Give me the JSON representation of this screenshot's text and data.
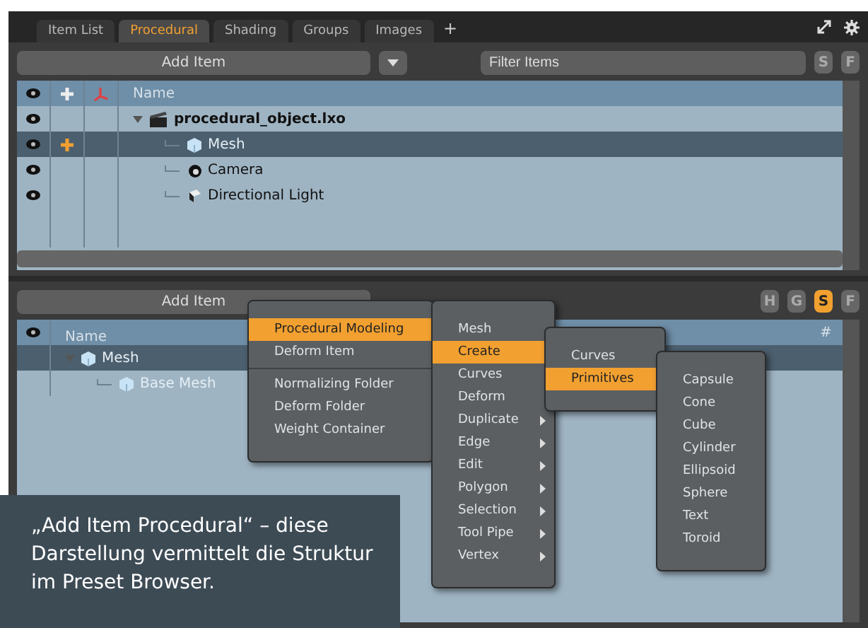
{
  "tabs": [
    {
      "label": "Item List",
      "selected": false
    },
    {
      "label": "Procedural",
      "selected": true
    },
    {
      "label": "Shading",
      "selected": false
    },
    {
      "label": "Groups",
      "selected": false
    },
    {
      "label": "Images",
      "selected": false
    }
  ],
  "add_tab": "+",
  "top_panel": {
    "add_button": "Add Item",
    "filter": {
      "placeholder": "Filter Items"
    },
    "toggles": [
      {
        "label": "S",
        "selected": false
      },
      {
        "label": "F",
        "selected": false
      }
    ],
    "header": "Name",
    "rows": [
      {
        "label": "procedural_object.lxo",
        "kind": "scene",
        "expanded": true,
        "selected": false,
        "dimmed": false,
        "editable": false,
        "children": [
          {
            "label": "Mesh",
            "kind": "mesh",
            "selected": true,
            "dimmed": true,
            "editable": true
          },
          {
            "label": "Camera",
            "kind": "camera",
            "selected": false,
            "dimmed": false,
            "editable": false
          },
          {
            "label": "Directional Light",
            "kind": "light",
            "selected": false,
            "dimmed": false,
            "editable": false
          }
        ]
      }
    ]
  },
  "bottom_panel": {
    "add_button": "Add Item",
    "toggles": [
      {
        "label": "H",
        "selected": false
      },
      {
        "label": "G",
        "selected": false
      },
      {
        "label": "S",
        "selected": true
      },
      {
        "label": "F",
        "selected": false
      }
    ],
    "header": "Name",
    "column_2": "#",
    "rows": [
      {
        "label": "Mesh",
        "kind": "mesh",
        "expanded": true,
        "selected": true,
        "dimmed": true,
        "children": [
          {
            "label": "Base Mesh",
            "kind": "mesh",
            "selected": false,
            "dimmed": true
          }
        ]
      }
    ]
  },
  "menus": [
    {
      "items": [
        {
          "kind": "item",
          "label": "Procedural Modeling",
          "selected": true
        },
        {
          "kind": "item",
          "label": "Deform Item",
          "selected": false
        },
        {
          "kind": "separator"
        },
        {
          "kind": "item",
          "label": "Normalizing Folder",
          "selected": false
        },
        {
          "kind": "item",
          "label": "Deform Folder",
          "selected": false
        },
        {
          "kind": "item",
          "label": "Weight Container",
          "selected": false
        }
      ]
    },
    {
      "items": [
        {
          "kind": "item",
          "label": "Mesh",
          "selected": false
        },
        {
          "kind": "item",
          "label": "Create",
          "selected": true
        },
        {
          "kind": "item",
          "label": "Curves",
          "selected": false
        },
        {
          "kind": "item",
          "label": "Deform",
          "selected": false
        },
        {
          "kind": "submenu",
          "label": "Duplicate",
          "selected": false
        },
        {
          "kind": "submenu",
          "label": "Edge",
          "selected": false
        },
        {
          "kind": "submenu",
          "label": "Edit",
          "selected": false
        },
        {
          "kind": "submenu",
          "label": "Polygon",
          "selected": false
        },
        {
          "kind": "submenu",
          "label": "Selection",
          "selected": false
        },
        {
          "kind": "submenu",
          "label": "Tool Pipe",
          "selected": false
        },
        {
          "kind": "submenu",
          "label": "Vertex",
          "selected": false
        }
      ]
    },
    {
      "items": [
        {
          "kind": "item",
          "label": "Curves",
          "selected": false
        },
        {
          "kind": "item",
          "label": "Primitives",
          "selected": true
        }
      ]
    },
    {
      "items": [
        {
          "kind": "item",
          "label": "Capsule",
          "selected": false
        },
        {
          "kind": "item",
          "label": "Cone",
          "selected": false
        },
        {
          "kind": "item",
          "label": "Cube",
          "selected": false
        },
        {
          "kind": "item",
          "label": "Cylinder",
          "selected": false
        },
        {
          "kind": "item",
          "label": "Ellipsoid",
          "selected": false
        },
        {
          "kind": "item",
          "label": "Sphere",
          "selected": false
        },
        {
          "kind": "item",
          "label": "Text",
          "selected": false
        },
        {
          "kind": "item",
          "label": "Toroid",
          "selected": false
        }
      ]
    }
  ],
  "caption": "„Add Item Procedural“ – diese Darstellung vermittelt die Struktur im Preset Browser."
}
